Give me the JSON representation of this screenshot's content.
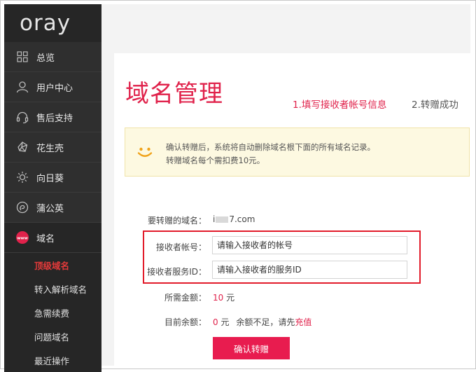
{
  "brand": {
    "logo_text": "oray"
  },
  "sidebar": {
    "items": [
      {
        "label": "总览",
        "icon": "grid-icon"
      },
      {
        "label": "用户中心",
        "icon": "user-icon"
      },
      {
        "label": "售后支持",
        "icon": "headset-icon"
      },
      {
        "label": "花生壳",
        "icon": "peanut-shell-icon"
      },
      {
        "label": "向日葵",
        "icon": "sunflower-icon"
      },
      {
        "label": "蒲公英",
        "icon": "dandelion-icon"
      },
      {
        "label": "域名",
        "icon": "www-icon"
      }
    ],
    "sub_items": [
      {
        "label": "顶级域名",
        "current": true
      },
      {
        "label": "转入解析域名"
      },
      {
        "label": "急需续费"
      },
      {
        "label": "问题域名"
      },
      {
        "label": "最近操作"
      }
    ]
  },
  "main": {
    "title": "域名管理",
    "steps": [
      "1.填写接收者帐号信息",
      "2.转赠成功"
    ],
    "notice": {
      "line1": "确认转赠后，系统将自动删除域名根下面的所有域名记录。",
      "line2": "转赠域名每个需扣费10元。",
      "icon": "smile-icon"
    },
    "form": {
      "domain_label": "要转赠的域名：",
      "domain_prefix": "i",
      "domain_suffix": "7.com",
      "account_label": "接收者帐号：",
      "account_placeholder": "请输入接收者的帐号",
      "service_id_label": "接收者服务ID：",
      "service_id_placeholder": "请输入接收者的服务ID",
      "fee_label": "所需金额：",
      "fee_amount": "10",
      "fee_unit": "元",
      "balance_label": "目前余额：",
      "balance_amount": "0",
      "balance_unit": "元",
      "insufficient_text": "余额不足，请先",
      "recharge_link": "充值",
      "confirm_button": "确认转赠"
    },
    "accent_color": "#e0224b",
    "highlight_box_color": "#e21b2a"
  }
}
